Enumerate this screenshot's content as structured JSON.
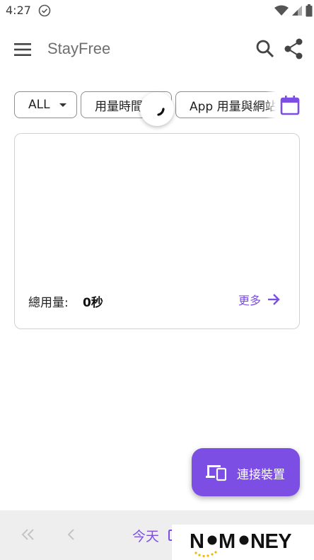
{
  "status_bar": {
    "time": "4:27"
  },
  "app_bar": {
    "title": "StayFree"
  },
  "filters": {
    "scope": "ALL",
    "metric": "用量時間",
    "view": "App 用量與網站"
  },
  "card": {
    "total_label": "總用量:",
    "total_value": "0秒",
    "more_label": "更多"
  },
  "fab": {
    "label": "連接裝置"
  },
  "bottom_nav": {
    "today_label": "今天"
  },
  "watermark": {
    "text": "NOMONEY"
  },
  "colors": {
    "accent": "#7c4ee4",
    "fab": "#7c4ee4",
    "bottom_bar": "#eeeeee"
  }
}
